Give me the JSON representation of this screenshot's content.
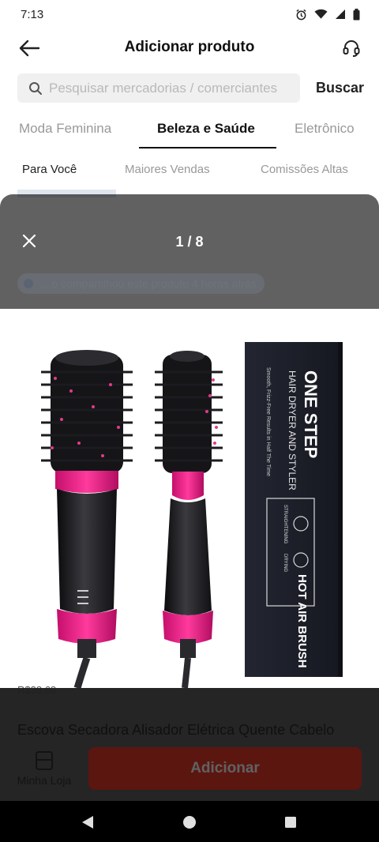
{
  "status_bar": {
    "time": "7:13",
    "icons": [
      "alarm-icon",
      "wifi-icon",
      "signal-icon",
      "battery-icon"
    ]
  },
  "header": {
    "title": "Adicionar produto",
    "back_icon": "arrow-left-icon",
    "support_icon": "headset-icon"
  },
  "search": {
    "placeholder": "Pesquisar mercadorias / comerciantes",
    "value": "",
    "button_label": "Buscar"
  },
  "category_tabs": [
    {
      "label": "Moda Feminina",
      "active": false
    },
    {
      "label": "Beleza e Saúde",
      "active": true
    },
    {
      "label": "Eletrônico",
      "active": false
    }
  ],
  "sub_tabs": [
    {
      "label": "Para Você",
      "active": true
    },
    {
      "label": "Maiores Vendas",
      "active": false
    },
    {
      "label": "Comissões Altas",
      "active": false
    }
  ],
  "modal": {
    "counter": "1 / 8",
    "share_notice": "... o compartilhou este produto 4 horas atrás",
    "image_text": {
      "brand": "ONE STEP",
      "subtitle": "HAIR DRYER AND STYLER",
      "small": "Smooth, Frizz-Free Results in Half The Time",
      "feature_left": "STRAIGHTENING",
      "feature_right": "DRYING",
      "product_line": "HOT AIR BRUSH"
    }
  },
  "product": {
    "price": "R$38,68",
    "name": "Escova Secadora Alisador Elétrica Quente Cabelo"
  },
  "bottom_bar": {
    "store_label": "Minha Loja",
    "add_label": "Adicionar"
  },
  "colors": {
    "accent": "#f03b2a",
    "brush_pink": "#e8157f",
    "box_dark": "#1d2029"
  }
}
